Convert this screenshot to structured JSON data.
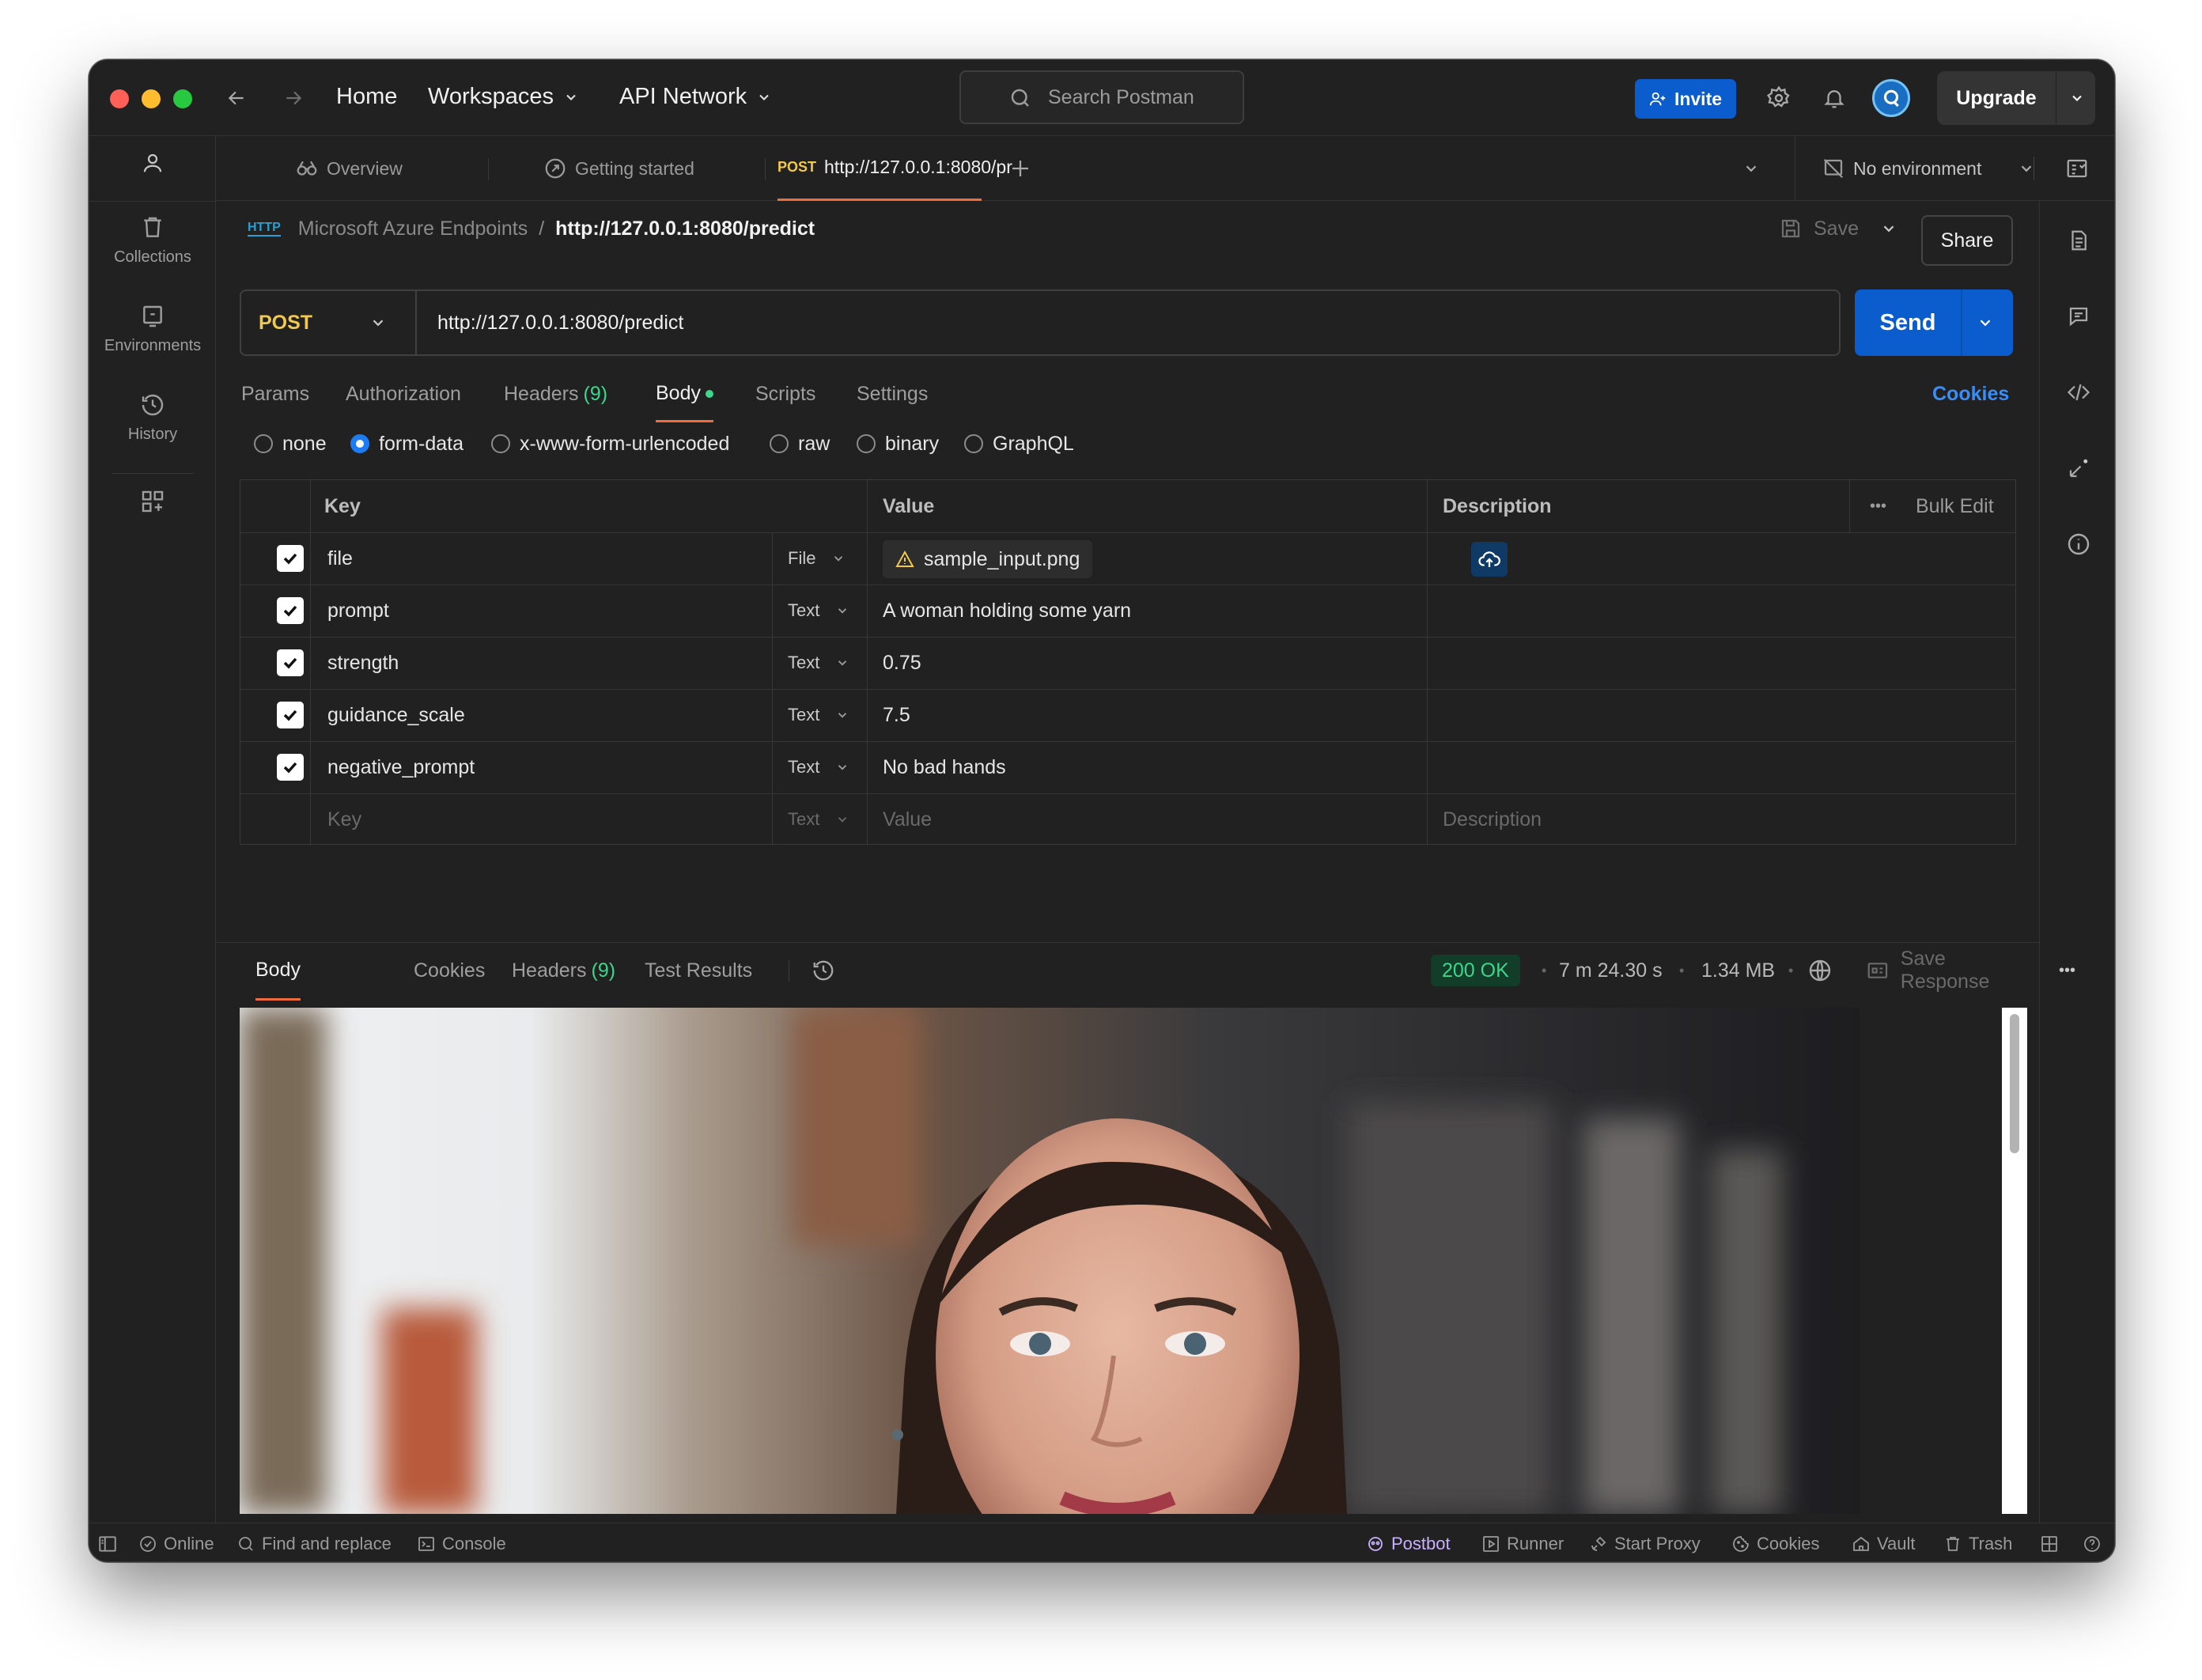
{
  "titlebar": {
    "nav": {
      "home": "Home",
      "workspaces": "Workspaces",
      "api_network": "API Network"
    },
    "search_placeholder": "Search Postman",
    "invite": "Invite",
    "upgrade": "Upgrade"
  },
  "sidebar": {
    "items": [
      {
        "label": "Collections",
        "icon": "trash-icon"
      },
      {
        "label": "Environments",
        "icon": "environment-icon"
      },
      {
        "label": "History",
        "icon": "history-icon"
      }
    ]
  },
  "tabs": [
    {
      "label": "Overview"
    },
    {
      "label": "Getting started"
    },
    {
      "method": "POST",
      "label": "http://127.0.0.1:8080/pr"
    }
  ],
  "environment": "No environment",
  "breadcrumb": {
    "collection": "Microsoft Azure Endpoints",
    "separator": "/",
    "request": "http://127.0.0.1:8080/predict",
    "http_badge": "HTTP"
  },
  "actions": {
    "save": "Save",
    "share": "Share"
  },
  "request": {
    "method": "POST",
    "url": "http://127.0.0.1:8080/predict",
    "send": "Send"
  },
  "request_tabs": {
    "params": "Params",
    "authorization": "Authorization",
    "headers": "Headers",
    "headers_count": "(9)",
    "body": "Body",
    "scripts": "Scripts",
    "settings": "Settings",
    "cookies": "Cookies"
  },
  "body_types": {
    "none": "none",
    "form_data": "form-data",
    "urlencoded": "x-www-form-urlencoded",
    "raw": "raw",
    "binary": "binary",
    "graphql": "GraphQL",
    "selected": "form-data"
  },
  "table": {
    "headers": {
      "key": "Key",
      "value": "Value",
      "description": "Description",
      "bulk_edit": "Bulk Edit"
    },
    "rows": [
      {
        "key": "file",
        "type": "File",
        "value": "sample_input.png",
        "checked": true
      },
      {
        "key": "prompt",
        "type": "Text",
        "value": "A woman holding some yarn",
        "checked": true
      },
      {
        "key": "strength",
        "type": "Text",
        "value": "0.75",
        "checked": true
      },
      {
        "key": "guidance_scale",
        "type": "Text",
        "value": "7.5",
        "checked": true
      },
      {
        "key": "negative_prompt",
        "type": "Text",
        "value": "No bad hands",
        "checked": true
      }
    ],
    "placeholder": {
      "key": "Key",
      "type": "Text",
      "value": "Value",
      "description": "Description"
    }
  },
  "response": {
    "tabs": {
      "body": "Body",
      "cookies": "Cookies",
      "headers": "Headers",
      "headers_count": "(9)",
      "test_results": "Test Results"
    },
    "status": "200 OK",
    "time": "7 m 24.30 s",
    "size": "1.34 MB",
    "save_response": "Save Response"
  },
  "statusbar": {
    "online": "Online",
    "find_replace": "Find and replace",
    "console": "Console",
    "postbot": "Postbot",
    "runner": "Runner",
    "start_proxy": "Start Proxy",
    "cookies": "Cookies",
    "vault": "Vault",
    "trash": "Trash"
  },
  "colors": {
    "accent": "#0b5ccc",
    "method_post": "#f2c94c",
    "status_ok": "#3ed68a",
    "postbot": "#c9b0ff"
  }
}
